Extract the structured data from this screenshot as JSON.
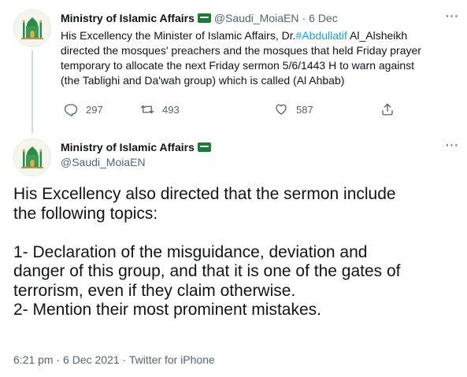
{
  "tweet1": {
    "author_name": "Ministry of Islamic Affairs",
    "author_handle": "@Saudi_MoiaEN",
    "separator": "·",
    "date": "6 Dec",
    "more_label": "···",
    "text_lines": [
      {
        "before": "His Excellency the Minister of Islamic Affairs, Dr.",
        "hashtag": "#Abdullatif",
        "after": " Al_Alsheikh"
      },
      {
        "text": "directed the mosques' preachers and the mosques that held Friday prayer"
      },
      {
        "text": "temporary to allocate the next Friday sermon 5/6/1443 H to warn against"
      },
      {
        "text": "(the Tablighi and Da'wah group) which is called (Al Ahbab)"
      }
    ],
    "actions": {
      "reply_icon": "reply-icon",
      "reply_count": "297",
      "retweet_icon": "retweet-icon",
      "retweet_count": "493",
      "like_icon": "heart-icon",
      "like_count": "587",
      "share_icon": "share-icon"
    }
  },
  "tweet2": {
    "author_name": "Ministry of Islamic Affairs",
    "author_handle": "@Saudi_MoiaEN",
    "more_label": "···",
    "body_lines": [
      "His Excellency also directed that the sermon include",
      "the following topics:",
      "",
      "1- Declaration of the misguidance, deviation and",
      "danger of this group, and that it is one of the gates of",
      "terrorism, even if they claim otherwise.",
      "2- Mention their most prominent mistakes."
    ],
    "meta": "6:21 pm · 6 Dec 2021 · Twitter for iPhone"
  },
  "colors": {
    "text": "#0f1419",
    "secondary": "#536471",
    "link": "#1d9bf0",
    "flag_green": "#1d7a3a",
    "thread_line": "#cfd9de"
  }
}
